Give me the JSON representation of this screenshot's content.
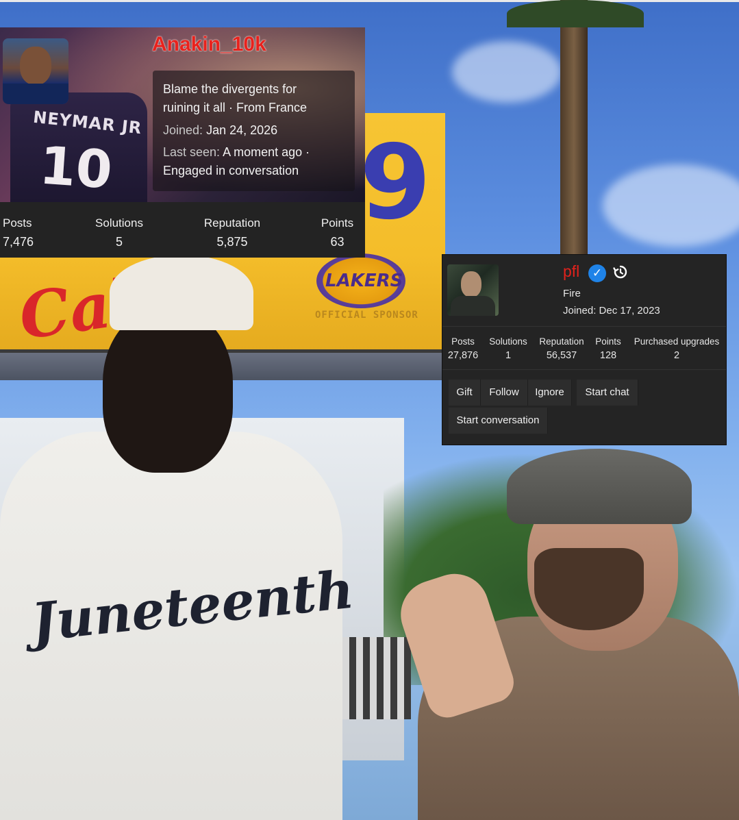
{
  "background": {
    "billboard_brand": "LAKERS",
    "billboard_sponsor": "OFFICIAL SPONSOR",
    "jersey_text": "Juneteenth"
  },
  "card1": {
    "username": "Anakin_10k",
    "username_color": "#e8221d",
    "banner_jersey_name": "NEYMAR JR",
    "banner_jersey_number": "10",
    "bio_line1": "Blame the divergents for",
    "bio_line2": "ruining it all · From France",
    "joined_label": "Joined:",
    "joined_value": "Jan 24, 2026",
    "last_seen_label": "Last seen:",
    "last_seen_value": "A moment ago ·",
    "activity": "Engaged in conversation",
    "stats": [
      {
        "label": "Posts",
        "value": "7,476"
      },
      {
        "label": "Solutions",
        "value": "5"
      },
      {
        "label": "Reputation",
        "value": "5,875"
      },
      {
        "label": "Points",
        "value": "63"
      }
    ]
  },
  "card2": {
    "username": "pfl",
    "username_color": "#e2221c",
    "verified_icon": "verified-check-icon",
    "history_icon": "history-icon",
    "user_title": "Fire",
    "joined": "Joined: Dec 17, 2023",
    "stats": [
      {
        "label": "Posts",
        "value": "27,876"
      },
      {
        "label": "Solutions",
        "value": "1"
      },
      {
        "label": "Reputation",
        "value": "56,537"
      },
      {
        "label": "Points",
        "value": "128"
      },
      {
        "label": "Purchased upgrades",
        "value": "2"
      }
    ],
    "buttons": {
      "gift": "Gift",
      "follow": "Follow",
      "ignore": "Ignore",
      "start_chat": "Start chat",
      "start_conversation": "Start conversation"
    }
  }
}
